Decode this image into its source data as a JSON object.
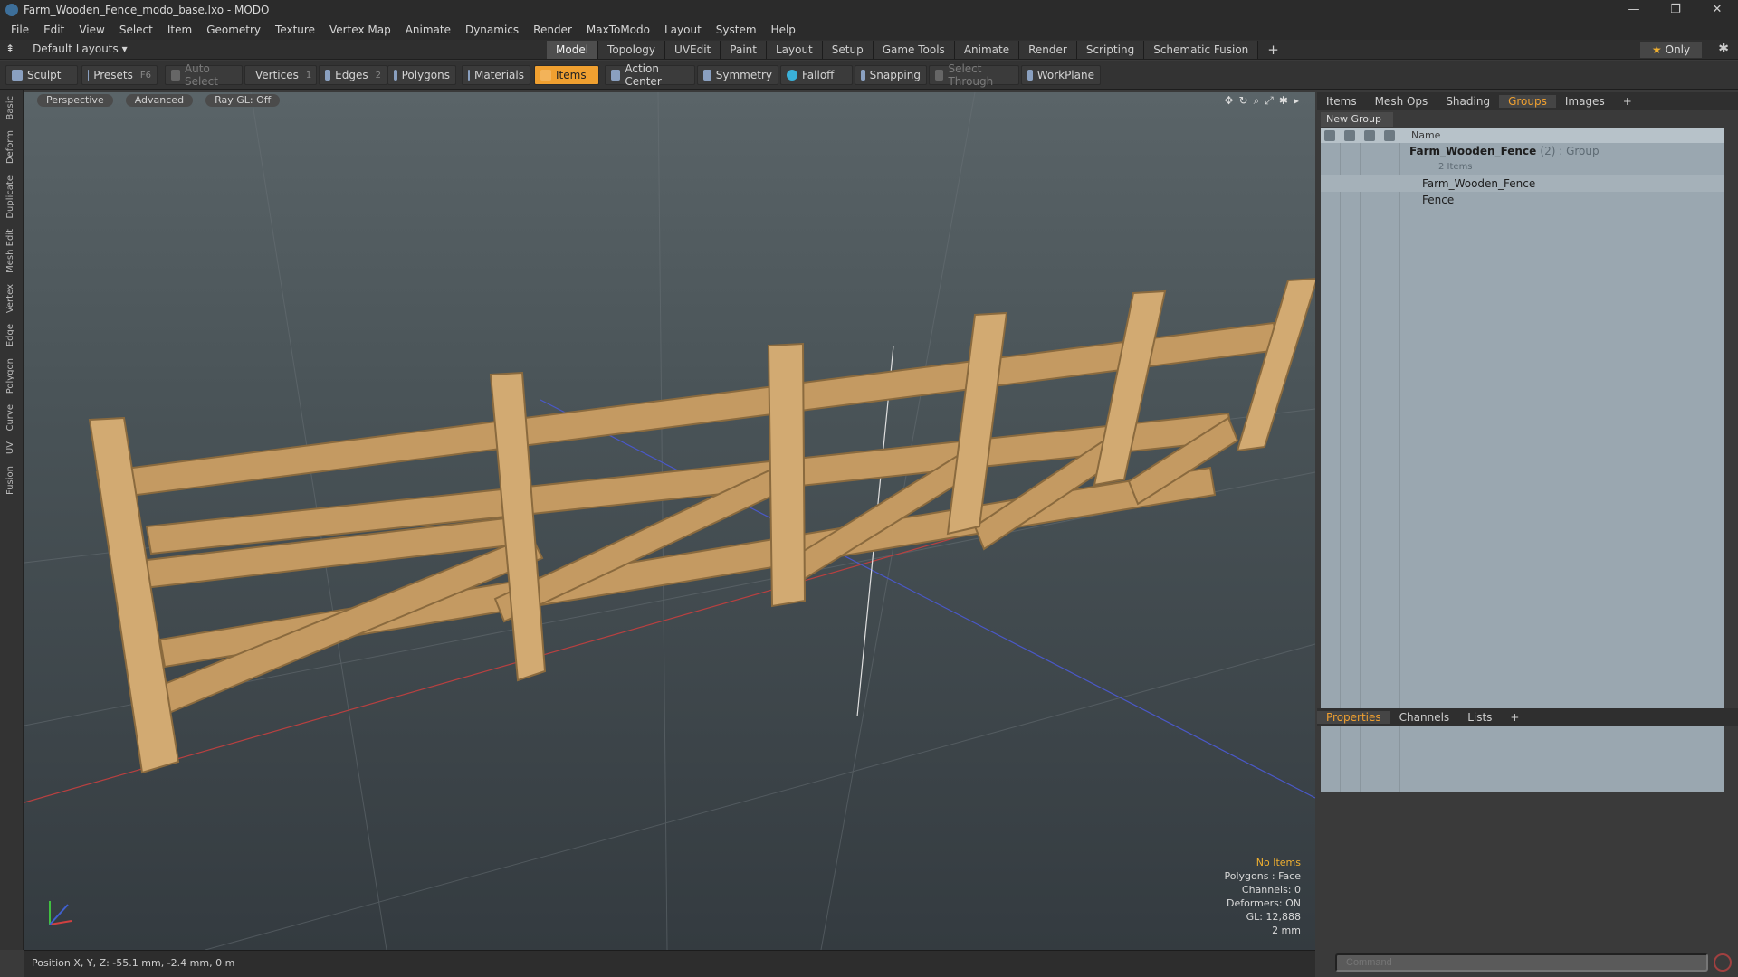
{
  "window": {
    "title": "Farm_Wooden_Fence_modo_base.lxo - MODO",
    "controls": [
      "—",
      "❐",
      "✕"
    ]
  },
  "menu": [
    "File",
    "Edit",
    "View",
    "Select",
    "Item",
    "Geometry",
    "Texture",
    "Vertex Map",
    "Animate",
    "Dynamics",
    "Render",
    "MaxToModo",
    "Layout",
    "System",
    "Help"
  ],
  "layout": {
    "default_label": "Default Layouts ▾",
    "only_label": "Only",
    "tabs": [
      "Model",
      "Topology",
      "UVEdit",
      "Paint",
      "Layout",
      "Setup",
      "Game Tools",
      "Animate",
      "Render",
      "Scripting",
      "Schematic Fusion"
    ],
    "plus": "+"
  },
  "toolbar": {
    "sculpt": "Sculpt",
    "presets": "Presets",
    "presets_key": "F6",
    "auto_select": "Auto Select",
    "vertices": "Vertices",
    "vertices_key": "1",
    "edges": "Edges",
    "edges_key": "2",
    "polygons": "Polygons",
    "materials": "Materials",
    "items": "Items",
    "action_center": "Action Center",
    "symmetry": "Symmetry",
    "falloff": "Falloff",
    "snapping": "Snapping",
    "select_through": "Select Through",
    "workplane": "WorkPlane"
  },
  "left_tabs": [
    "Basic",
    "Deform",
    "Duplicate",
    "Mesh Edit",
    "Vertex",
    "Edge",
    "Polygon",
    "Curve",
    "UV",
    "Fusion"
  ],
  "viewport": {
    "view": "Perspective",
    "mode": "Advanced",
    "raygl": "Ray GL: Off",
    "info": {
      "items": "No Items",
      "polygons": "Polygons : Face",
      "channels": "Channels: 0",
      "deformers": "Deformers: ON",
      "gl": "GL: 12,888",
      "size": "2 mm"
    }
  },
  "status": {
    "position": "Position X, Y, Z:  -55.1 mm, -2.4 mm, 0 m"
  },
  "right_panel": {
    "tabs": [
      "Items",
      "Mesh Ops",
      "Shading",
      "Groups",
      "Images",
      "+"
    ],
    "new_group": "New Group",
    "header_name": "Name",
    "group": {
      "name": "Farm_Wooden_Fence",
      "suffix": "(2) : Group",
      "count": "2 Items",
      "children": [
        "Farm_Wooden_Fence",
        "Fence"
      ]
    },
    "bottom_tabs": [
      "Properties",
      "Channels",
      "Lists",
      "+"
    ]
  },
  "command": {
    "placeholder": "Command"
  },
  "colors": {
    "accent": "#f0a030",
    "viewport_top": "#5a6468",
    "wood": "#c49a62"
  }
}
